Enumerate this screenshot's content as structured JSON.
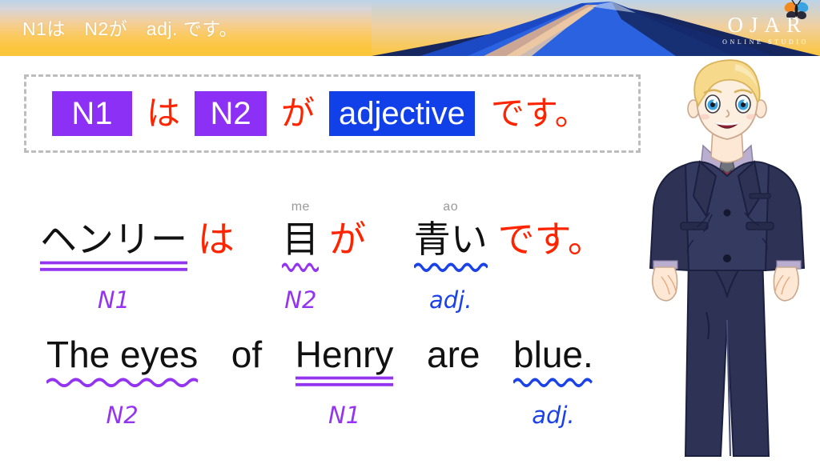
{
  "header": {
    "title": "N1は　N2が　adj. です。",
    "logo_main": "OJAR",
    "logo_sub": "ONLINE STUDIO",
    "butterfly_icon": "butterfly-icon",
    "mountain_icon": "mount-fuji-illustration",
    "band_color": "#fcc63c",
    "sky_color": "#bcd3e8"
  },
  "formula": {
    "n1": "N1",
    "particle_wa": "は",
    "n2": "N2",
    "particle_ga": "が",
    "adjective": "adjective",
    "desu": "です。",
    "chip_purple": "#8c30f5",
    "chip_blue": "#1240e8",
    "particle_color": "#ff2400",
    "border_color": "#bdbdbd"
  },
  "japanese_sentence": {
    "subject": "ヘンリー",
    "subject_label": "N1",
    "subject_mark": "double-line",
    "particle_wa": "は",
    "object": "目",
    "object_furigana": "me",
    "object_label": "N2",
    "object_mark": "squiggle",
    "particle_ga": "が",
    "adjective": "青い",
    "adjective_furigana": "ao",
    "adjective_label": "adj.",
    "adjective_mark": "squiggle",
    "copula": "です。"
  },
  "english_sentence": {
    "part1": "The eyes",
    "part1_label": "N2",
    "part1_mark": "squiggle",
    "part2": "of",
    "part3": "Henry",
    "part3_label": "N1",
    "part3_mark": "double-line",
    "part4": "are",
    "part5": "blue.",
    "part5_label": "adj.",
    "part5_mark": "squiggle"
  },
  "colors": {
    "purple": "#9335f0",
    "blue": "#1a42e8",
    "red": "#ff2400",
    "furigana_gray": "#9a9a9a",
    "text_black": "#111111"
  },
  "character": {
    "name": "teacher-avatar",
    "hair_color": "#f6d98a",
    "suit_color": "#2e3355",
    "shirt_color": "#b9aed0",
    "tie_color": "#a8283f"
  }
}
